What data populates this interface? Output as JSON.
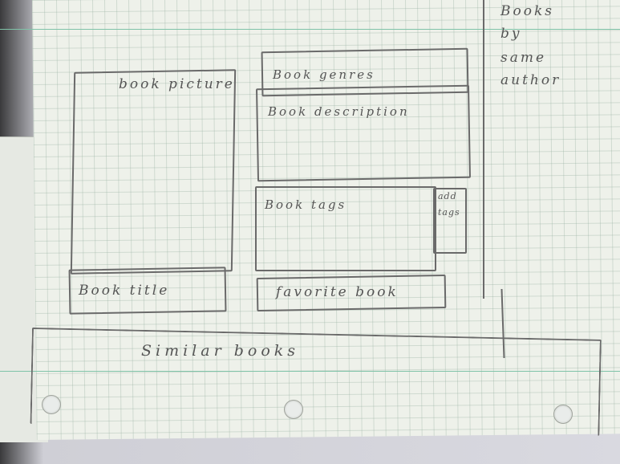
{
  "sketch": {
    "book_picture_label": "book picture",
    "book_title_label": "Book title",
    "book_genres_label": "Book genres",
    "book_description_label": "Book description",
    "book_tags_label": "Book tags",
    "add_tags_line1": "add",
    "add_tags_line2": "tags",
    "favorite_book_label": "favorite book",
    "similar_books_label": "Similar books",
    "sidebar_line1": "Books",
    "sidebar_line2": "by",
    "sidebar_line3": "same",
    "sidebar_line4": "author"
  },
  "colors": {
    "paper": "#eef1ea",
    "grid": "#96afa0",
    "pencil": "#6a6a6a",
    "margin_line": "#7fc3a8"
  }
}
